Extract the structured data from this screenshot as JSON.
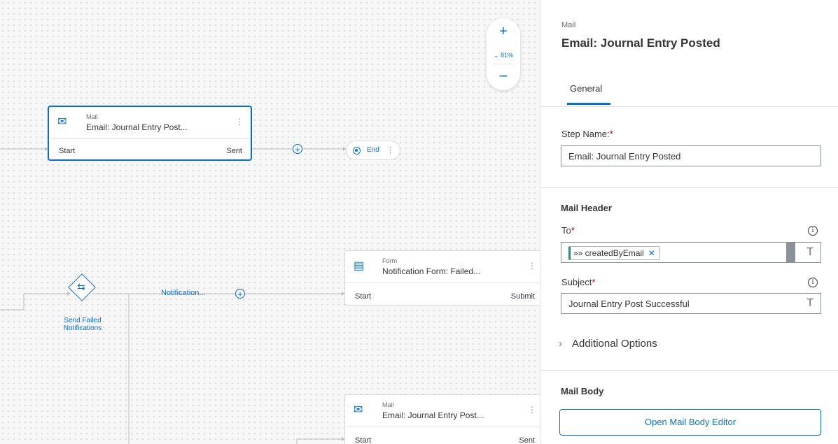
{
  "canvas": {
    "zoom": {
      "in": "+",
      "level": "⌄ 81%",
      "out": "−"
    },
    "nodes": [
      {
        "kind": "Mail",
        "title": "Email: Journal Entry Post...",
        "left_port": "Start",
        "right_port": "Sent",
        "selected": true
      },
      {
        "kind": "Form",
        "title": "Notification Form: Failed...",
        "left_port": "Start",
        "right_port": "Submit"
      },
      {
        "kind": "Mail",
        "title": "Email: Journal Entry Post...",
        "left_port": "Start",
        "right_port": "Sent"
      }
    ],
    "end_node": {
      "label": "End"
    },
    "gateway": {
      "label": "Send Failed Notifications"
    },
    "route_label": "Notification...",
    "icons": {
      "mail": "envelope-icon",
      "form": "form-icon",
      "gateway": "branch-icon",
      "add": "plus-circle-icon"
    }
  },
  "panel": {
    "kind": "Mail",
    "title": "Email: Journal Entry Posted",
    "tabs": [
      {
        "label": "General",
        "active": true
      }
    ],
    "step_name": {
      "label": "Step Name:",
      "required": "*",
      "value": "Email: Journal Entry Posted"
    },
    "mail_header": {
      "heading": "Mail Header",
      "to": {
        "label": "To",
        "required": "*",
        "token": "»» createdByEmail",
        "token_remove": "✕",
        "type_button": "T"
      },
      "subject": {
        "label": "Subject",
        "required": "*",
        "value": "Journal Entry Post Successful",
        "type_button": "T"
      },
      "info_icon": "i"
    },
    "additional_options": {
      "chevron": "›",
      "label": "Additional Options"
    },
    "mail_body": {
      "heading": "Mail Body",
      "button": "Open Mail Body Editor"
    }
  },
  "colors": {
    "accent": "#0a6ed1",
    "required": "#bb0000",
    "token_bar": "#3a8a7a"
  }
}
